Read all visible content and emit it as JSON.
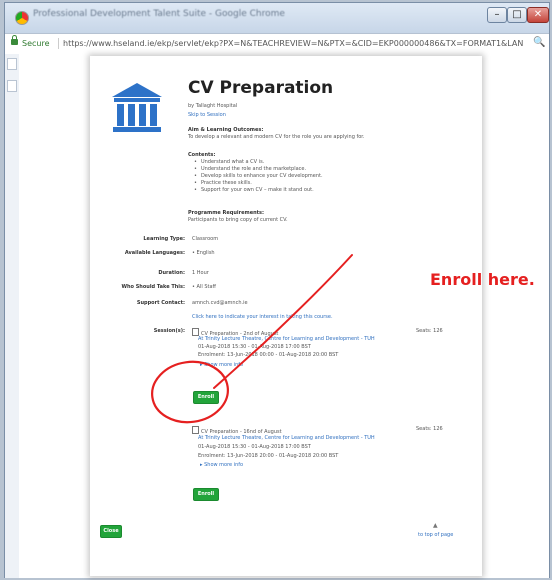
{
  "browser": {
    "window_title": "Professional Development Talent Suite - Google Chrome",
    "secure_label": "Secure",
    "url": "https://www.hseland.ie/ekp/servlet/ekp?PX=N&TEACHREVIEW=N&PTX=&CID=EKP000000486&TX=FORMAT1&LANGUAGE...",
    "minimize": "–",
    "maximize": "□",
    "close": "✕"
  },
  "course": {
    "title": "CV Preparation",
    "provider": "by Tallaght Hospital",
    "skip_link": "Skip to Session",
    "aim_heading": "Aim & Learning Outcomes:",
    "aim_text": "To develop a relevant and modern CV for the role you are applying for.",
    "contents_heading": "Contents:",
    "contents": [
      "Understand what a CV is.",
      "Understand the role and the marketplace.",
      "Develop skills to enhance your CV development.",
      "Practice these skills.",
      "Support for your own CV – make it stand out."
    ],
    "requirements_heading": "Programme Requirements:",
    "requirements_text": "Participants to bring copy of current CV."
  },
  "details": [
    {
      "label": "Learning Type:",
      "value": "Classroom"
    },
    {
      "label": "Available Languages:",
      "value": "•  English"
    },
    {
      "label": "Duration:",
      "value": "1 Hour"
    },
    {
      "label": "Who Should Take This:",
      "value": "•  All Staff"
    },
    {
      "label": "Support Contact:",
      "value": "amnch.cvd@amnch.ie"
    }
  ],
  "interest_link": "Click here to indicate your interest in taking this course.",
  "sessions_label": "Session(s):",
  "sessions": [
    {
      "name": "CV Preparation - 2nd of August",
      "seats": "Seats: 126",
      "location": "At Trinity Lecture Theatre, Centre for Learning and Development - TUH",
      "dates": "01-Aug-2018 15:30 - 01-Aug-2018 17:00 BST",
      "enrolment": "Enrolment: 13-Jun-2018 00:00 - 01-Aug-2018 20:00 BST",
      "more": "▸ Show more info",
      "enroll": "Enroll"
    },
    {
      "name": "CV Preparation - 16nd of August",
      "seats": "Seats: 126",
      "location": "At Trinity Lecture Theatre, Centre for Learning and Development - TUH",
      "dates": "01-Aug-2018 15:30 - 01-Aug-2018 17:00 BST",
      "enrolment": "Enrolment: 13-Jun-2018 20:00 - 01-Aug-2018 20:00 BST",
      "more": "▸ Show more info",
      "enroll": "Enroll"
    }
  ],
  "close_button": "Close",
  "top_link": "to top of page",
  "annotation": "Enroll here.",
  "colors": {
    "accent_green": "#22a43a",
    "annotation_red": "#e52020",
    "link_blue": "#2f6fbf",
    "logo_blue": "#2d72c8"
  }
}
